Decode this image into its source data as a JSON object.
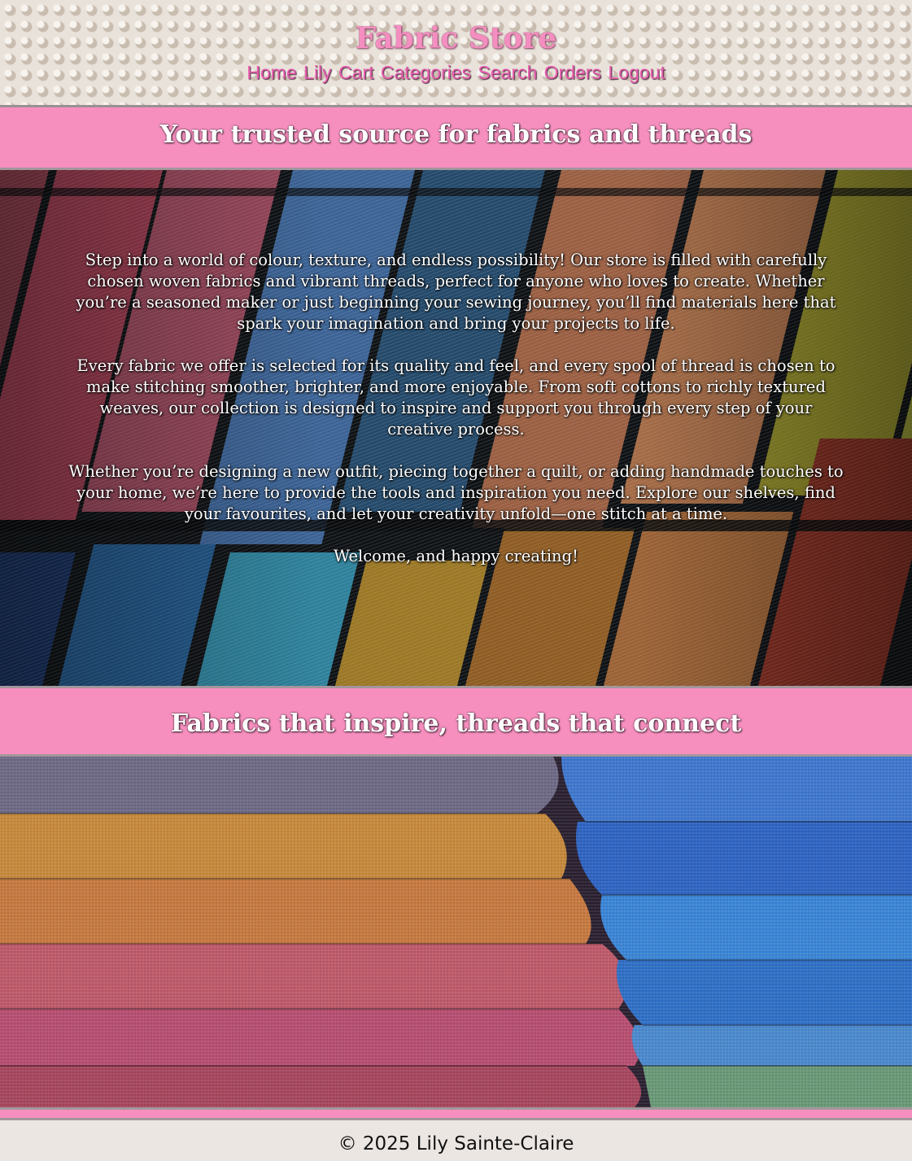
{
  "header": {
    "site_title": "Fabric Store",
    "nav": [
      "Home",
      "Lily",
      "Cart",
      "Categories",
      "Search",
      "Orders",
      "Logout"
    ]
  },
  "banner1": {
    "heading": "Your trusted source for fabrics and threads"
  },
  "hero": {
    "paragraphs": [
      "Step into a world of colour, texture, and endless possibility! Our store is filled with carefully chosen woven fabrics and vibrant threads, perfect for anyone who loves to create. Whether you’re a seasoned maker or just beginning your sewing journey, you’ll find materials here that spark your imagination and bring your projects to life.",
      "Every fabric we offer is selected for its quality and feel, and every spool of thread is chosen to make stitching smoother, brighter, and more enjoyable. From soft cottons to richly textured weaves, our collection is designed to inspire and support you through every step of your creative process.",
      "Whether you’re designing a new outfit, piecing together a quilt, or adding handmade touches to your home, we’re here to provide the tools and inspiration you need. Explore our shelves, find your favourites, and let your creativity unfold—one stitch at a time.",
      "Welcome, and happy creating!"
    ]
  },
  "banner2": {
    "heading": "Fabrics that inspire, threads that connect"
  },
  "footer": {
    "copyright": "© 2025 Lily Sainte-Claire"
  },
  "colors": {
    "pink": "#f68fbe",
    "nav_pink": "#e75fb0",
    "rule": "#a3969c"
  }
}
